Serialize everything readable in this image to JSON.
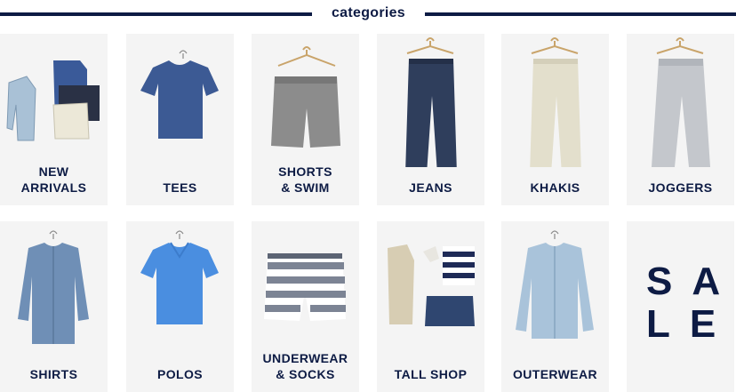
{
  "header": {
    "title": "categories"
  },
  "categories": [
    {
      "label": "NEW\nARRIVALS",
      "icon": "new-arrivals-outfit-icon"
    },
    {
      "label": "TEES",
      "icon": "tee-shirt-icon"
    },
    {
      "label": "SHORTS\n& SWIM",
      "icon": "shorts-icon"
    },
    {
      "label": "JEANS",
      "icon": "jeans-icon"
    },
    {
      "label": "KHAKIS",
      "icon": "khakis-icon"
    },
    {
      "label": "JOGGERS",
      "icon": "joggers-icon"
    },
    {
      "label": "SHIRTS",
      "icon": "button-shirt-icon"
    },
    {
      "label": "POLOS",
      "icon": "polo-shirt-icon"
    },
    {
      "label": "UNDERWEAR\n& SOCKS",
      "icon": "boxers-icon"
    },
    {
      "label": "TALL SHOP",
      "icon": "tall-shop-outfit-icon"
    },
    {
      "label": "OUTERWEAR",
      "icon": "denim-jacket-icon"
    }
  ],
  "sale": {
    "text": "SA\nLE"
  },
  "colors": {
    "navy": "#0d1b44",
    "tile_bg": "#f4f4f4"
  }
}
